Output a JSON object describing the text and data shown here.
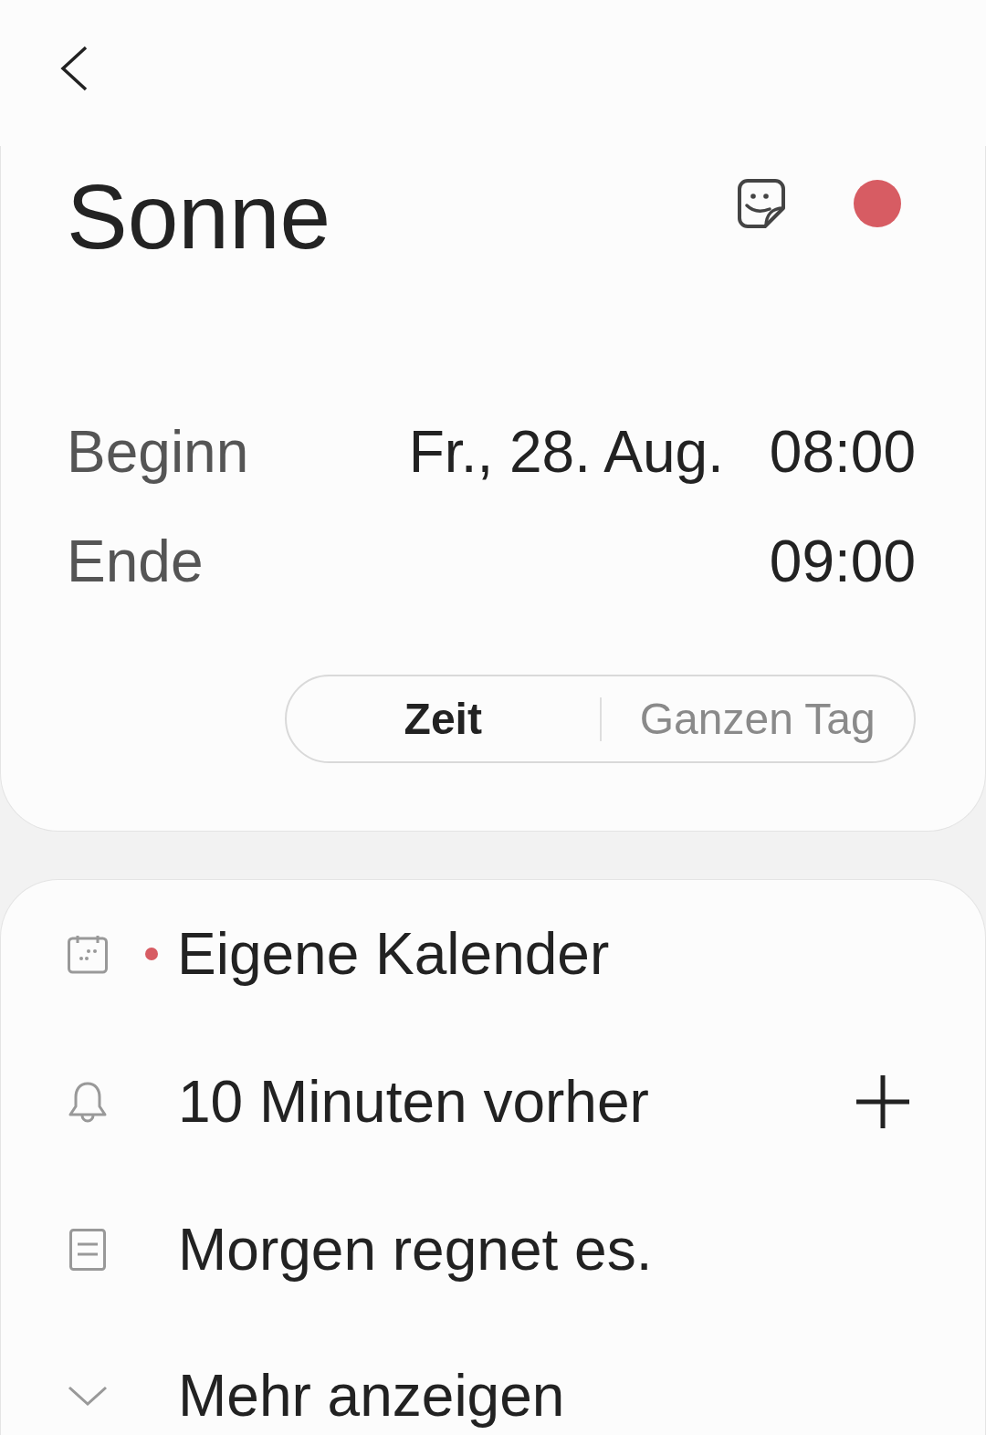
{
  "event": {
    "title": "Sonne",
    "color": "#d75c63"
  },
  "schedule": [
    {
      "label": "Beginn",
      "date": "Fr., 28. Aug.",
      "time": "08:00"
    },
    {
      "label": "Ende",
      "time": "09:00"
    }
  ],
  "mode_toggle": {
    "options": [
      {
        "label": "Zeit",
        "selected": true
      },
      {
        "label": "Ganzen Tag",
        "selected": false
      }
    ]
  },
  "details": [
    {
      "kind": "calendar",
      "text": "Eigene Kalender",
      "color": "#d75c63"
    },
    {
      "kind": "reminder",
      "text": "10 Minuten vorher"
    },
    {
      "kind": "note",
      "text": "Morgen regnet es."
    },
    {
      "kind": "expand",
      "text": "Mehr anzeigen"
    }
  ]
}
